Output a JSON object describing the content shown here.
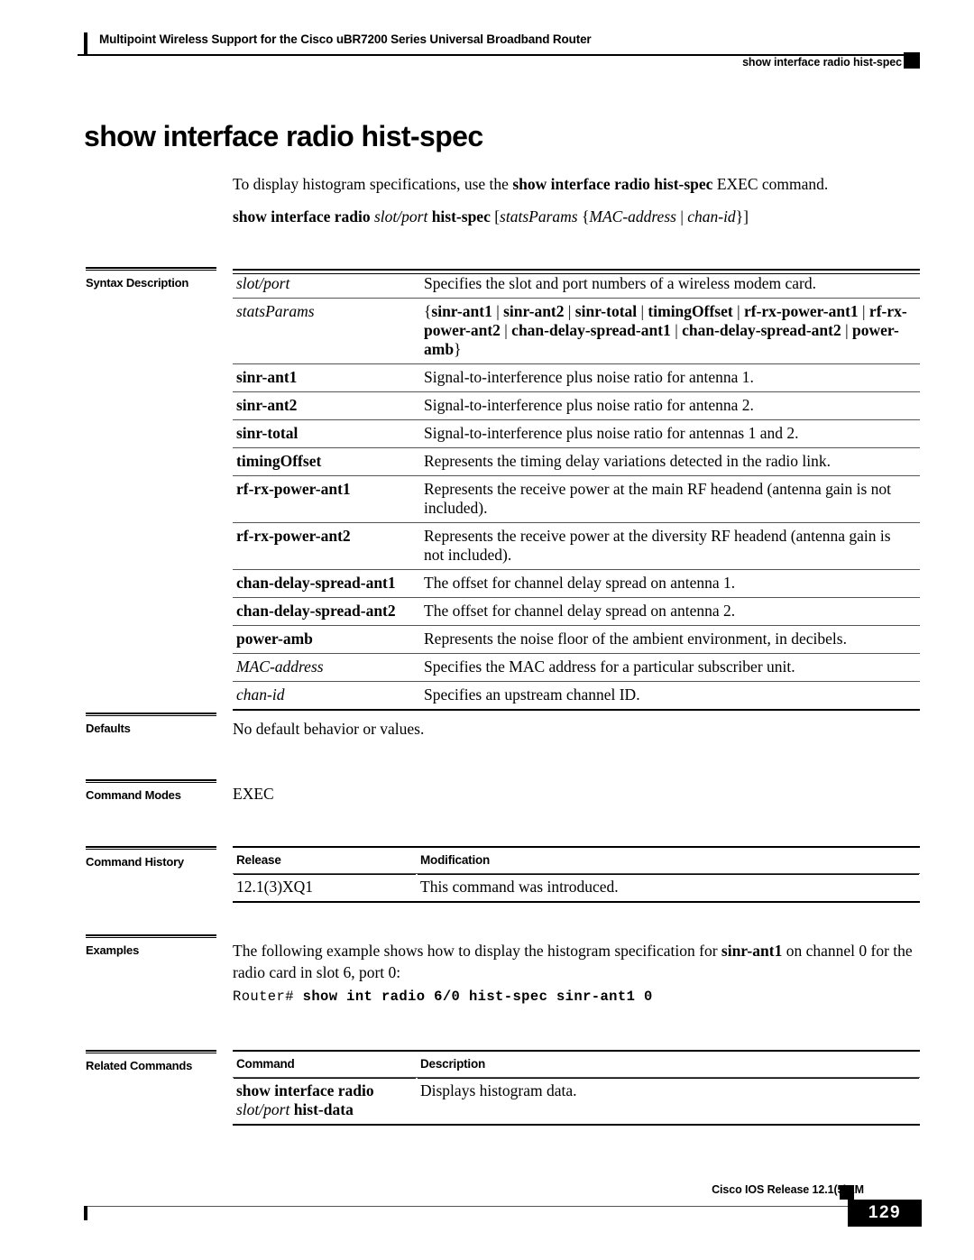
{
  "header": {
    "book_title": "Multipoint Wireless Support for the Cisco uBR7200 Series Universal Broadband Router",
    "running_head": "show interface radio hist-spec"
  },
  "command": {
    "heading": "show interface radio hist-spec",
    "intro_pre": "To display histogram specifications, use the ",
    "intro_bold": "show interface radio hist-spec",
    "intro_post": " EXEC command.",
    "syntax": {
      "cmd": "show interface radio",
      "arg1": "slot/port",
      "keyword": "hist-spec",
      "open_bracket": " [",
      "stats": "statsParams",
      "open_brace": " {",
      "mac": "MAC-address",
      "pipe": " | ",
      "chan": "chan-id",
      "close": "}]"
    }
  },
  "sections": {
    "syntax_description": "Syntax Description",
    "defaults": "Defaults",
    "command_modes": "Command Modes",
    "command_history": "Command History",
    "examples": "Examples",
    "related_commands": "Related Commands"
  },
  "syntax_table": {
    "rows": [
      {
        "term": "slot/port",
        "style": "italic",
        "desc": "Specifies the slot and port numbers of a wireless modem card."
      },
      {
        "term": "statsParams",
        "style": "italic",
        "desc_parts": [
          {
            "t": "{",
            "b": false
          },
          {
            "t": "sinr-ant1",
            "b": true
          },
          {
            "t": " | ",
            "b": false
          },
          {
            "t": "sinr-ant2",
            "b": true
          },
          {
            "t": " | ",
            "b": false
          },
          {
            "t": "sinr-total",
            "b": true
          },
          {
            "t": " | ",
            "b": false
          },
          {
            "t": "timingOffset",
            "b": true
          },
          {
            "t": " | ",
            "b": false
          },
          {
            "t": "rf-rx-power-ant1",
            "b": true
          },
          {
            "t": " | ",
            "b": false
          },
          {
            "t": "rf-rx-power-ant2",
            "b": true
          },
          {
            "t": " | ",
            "b": false
          },
          {
            "t": "chan-delay-spread-ant1",
            "b": true
          },
          {
            "t": " | ",
            "b": false
          },
          {
            "t": "chan-delay-spread-ant2",
            "b": true
          },
          {
            "t": " | ",
            "b": false
          },
          {
            "t": "power-amb",
            "b": true
          },
          {
            "t": "}",
            "b": false
          }
        ]
      },
      {
        "term": "sinr-ant1",
        "style": "bold",
        "desc": "Signal-to-interference plus noise ratio for antenna 1."
      },
      {
        "term": "sinr-ant2",
        "style": "bold",
        "desc": "Signal-to-interference plus noise ratio for antenna 2."
      },
      {
        "term": "sinr-total",
        "style": "bold",
        "desc": "Signal-to-interference plus noise ratio for antennas 1 and 2."
      },
      {
        "term": "timingOffset",
        "style": "bold",
        "desc": "Represents the timing delay variations detected in the radio link."
      },
      {
        "term": "rf-rx-power-ant1",
        "style": "bold",
        "desc": "Represents the receive power at the main RF headend (antenna gain is not included)."
      },
      {
        "term": "rf-rx-power-ant2",
        "style": "bold",
        "desc": "Represents the receive power at the diversity RF headend (antenna gain is not included)."
      },
      {
        "term": "chan-delay-spread-ant1",
        "style": "bold",
        "desc": "The offset for channel delay spread on antenna 1."
      },
      {
        "term": "chan-delay-spread-ant2",
        "style": "bold",
        "desc": "The offset for channel delay spread on antenna 2."
      },
      {
        "term": "power-amb",
        "style": "bold",
        "desc": "Represents the noise floor of the ambient environment, in decibels."
      },
      {
        "term": "MAC-address",
        "style": "italic",
        "desc": "Specifies the MAC address for a particular subscriber unit."
      },
      {
        "term": "chan-id",
        "style": "italic",
        "desc": "Specifies an upstream channel ID."
      }
    ]
  },
  "defaults": {
    "text": "No default behavior or values."
  },
  "command_modes": {
    "text": "EXEC"
  },
  "command_history": {
    "columns": [
      "Release",
      "Modification"
    ],
    "rows": [
      {
        "release": "12.1(3)XQ1",
        "modification": "This command was introduced."
      }
    ]
  },
  "examples": {
    "intro_pre": "The following example shows how to display the histogram specification for ",
    "intro_bold": "sinr-ant1",
    "intro_post": " on channel 0 for the radio card in slot 6, port 0:",
    "code_prompt": "Router# ",
    "code_command": "show int radio 6/0 hist-spec sinr-ant1 0"
  },
  "related_commands": {
    "columns": [
      "Command",
      "Description"
    ],
    "rows": [
      {
        "cmd_bold1": "show interface radio",
        "cmd_italic": "slot/port",
        "cmd_bold2": " hist-data",
        "description": "Displays histogram data."
      }
    ]
  },
  "footer": {
    "release": "Cisco IOS Release 12.1(5)XM",
    "page_number": "129"
  }
}
